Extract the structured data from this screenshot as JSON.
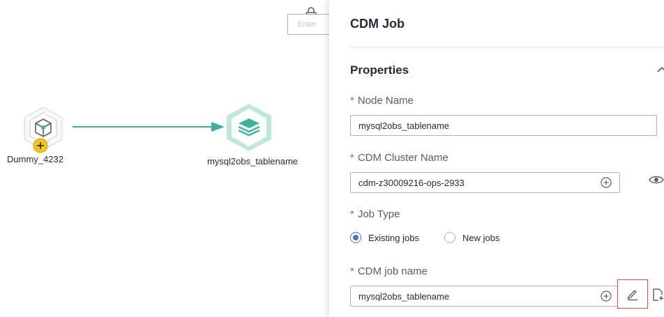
{
  "canvas": {
    "search_placeholder": "Enter"
  },
  "nodes": [
    {
      "label": "Dummy_4232"
    },
    {
      "label": "mysql2obs_tablename"
    }
  ],
  "panel": {
    "title": "CDM Job",
    "section_title": "Properties",
    "node_name": {
      "label": "Node Name",
      "value": "mysql2obs_tablename"
    },
    "cluster_name": {
      "label": "CDM Cluster Name",
      "value": "cdm-z30009216-ops-2933"
    },
    "job_type": {
      "label": "Job Type",
      "options": [
        "Existing jobs",
        "New jobs"
      ],
      "selected": "Existing jobs"
    },
    "job_name": {
      "label": "CDM job name",
      "value": "mysql2obs_tablename"
    }
  },
  "colors": {
    "accent": "#526ecc",
    "required": "#e54545",
    "node_teal": "#3ab39a",
    "node_ring": "#bfe8dc",
    "dummy_badge": "#f5c518"
  },
  "icons": [
    "lock-icon",
    "cube-icon",
    "plus-badge-icon",
    "layers-icon",
    "chevron-up-icon",
    "plus-circle-icon",
    "eye-icon",
    "pencil-icon",
    "new-file-icon"
  ]
}
